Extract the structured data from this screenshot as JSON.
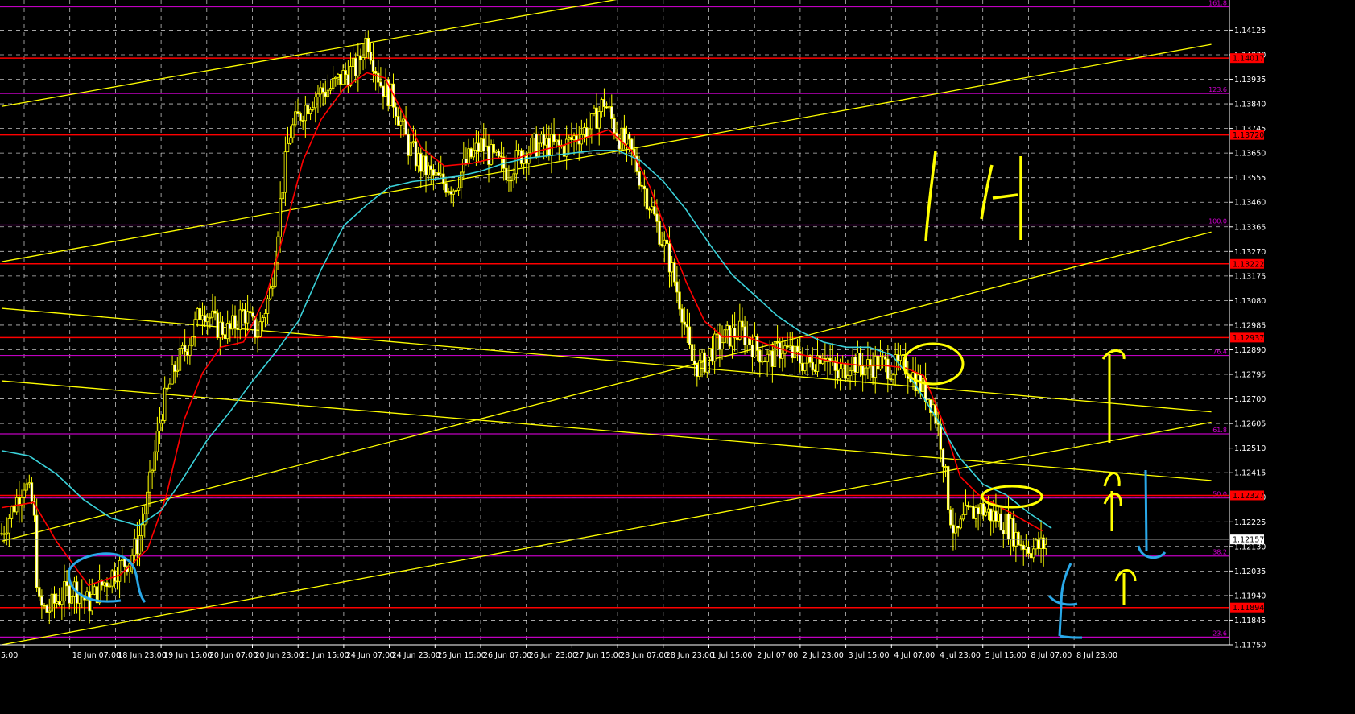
{
  "chart_data": {
    "type": "candlestick",
    "symbol": "",
    "price_axis": {
      "range": [
        1.1175,
        1.14215
      ],
      "ticks": [
        "1.14125",
        "1.14030",
        "1.13935",
        "1.13840",
        "1.13745",
        "1.13650",
        "1.13555",
        "1.13460",
        "1.13365",
        "1.13270",
        "1.13175",
        "1.13080",
        "1.12985",
        "1.12890",
        "1.12795",
        "1.12700",
        "1.12605",
        "1.12510",
        "1.12415",
        "1.12320",
        "1.12225",
        "1.12130",
        "1.12035",
        "1.11940",
        "1.11845",
        "1.11750"
      ],
      "tick_values": [
        1.14125,
        1.1403,
        1.13935,
        1.1384,
        1.13745,
        1.1365,
        1.13555,
        1.1346,
        1.13365,
        1.1327,
        1.13175,
        1.1308,
        1.12985,
        1.1289,
        1.12795,
        1.127,
        1.12605,
        1.1251,
        1.12415,
        1.1232,
        1.12225,
        1.1213,
        1.12035,
        1.1194,
        1.11845,
        1.1175
      ]
    },
    "time_axis": {
      "labels": [
        "5:00",
        "18 Jun 07:00",
        "18 Jun 23:00",
        "19 Jun 15:00",
        "20 Jun 07:00",
        "20 Jun 23:00",
        "21 Jun 15:00",
        "24 Jun 07:00",
        "24 Jun 23:00",
        "25 Jun 15:00",
        "26 Jun 07:00",
        "26 Jun 23:00",
        "27 Jun 15:00",
        "28 Jun 07:00",
        "28 Jun 23:00",
        "1 Jul 15:00",
        "2 Jul 07:00",
        "2 Jul 23:00",
        "3 Jul 15:00",
        "4 Jul 07:00",
        "4 Jul 23:00",
        "5 Jul 15:00",
        "8 Jul 07:00",
        "8 Jul 23:00"
      ],
      "positions": [
        0,
        1.0,
        2.0,
        3.0,
        4.0,
        5.0,
        6.0,
        7.0,
        8.0,
        9.0,
        10.0,
        11.0,
        12.0,
        13.0,
        14.0,
        15.0,
        16.0,
        17.0,
        18.0,
        19.0,
        20.0,
        21.0,
        22.0,
        23.0
      ]
    },
    "current_price": {
      "value": 1.12157,
      "label": "1.12157"
    },
    "horizontal_levels": [
      {
        "value": 1.14017,
        "label": "1.14017",
        "color": "#ff0000"
      },
      {
        "value": 1.1372,
        "label": "1.13720",
        "color": "#ff0000"
      },
      {
        "value": 1.13222,
        "label": "1.13222",
        "color": "#ff0000"
      },
      {
        "value": 1.12937,
        "label": "1.12937",
        "color": "#ff0000"
      },
      {
        "value": 1.12327,
        "label": "1.12327",
        "color": "#ff0000"
      },
      {
        "value": 1.11894,
        "label": "1.11894",
        "color": "#ff0000"
      }
    ],
    "fib_levels": [
      {
        "value": 1.14215,
        "label": "161.8"
      },
      {
        "value": 1.1388,
        "label": "123.6"
      },
      {
        "value": 1.13372,
        "label": "100.0"
      },
      {
        "value": 1.12868,
        "label": "76.4"
      },
      {
        "value": 1.12565,
        "label": "61.8"
      },
      {
        "value": 1.12317,
        "label": "50.0"
      },
      {
        "value": 1.12093,
        "label": "38.2"
      },
      {
        "value": 1.1178,
        "label": "23.6"
      }
    ],
    "trendlines": [
      {
        "p1": [
          0,
          1.1383
        ],
        "p2": [
          23.8,
          1.1456
        ]
      },
      {
        "p1": [
          0,
          1.1323
        ],
        "p2": [
          26.5,
          1.1407
        ]
      },
      {
        "p1": [
          0,
          1.1215
        ],
        "p2": [
          26.5,
          1.13345
        ]
      },
      {
        "p1": [
          0,
          1.1175
        ],
        "p2": [
          26.5,
          1.1261
        ]
      },
      {
        "p1": [
          0,
          1.1305
        ],
        "p2": [
          26.5,
          1.1265
        ]
      },
      {
        "p1": [
          0,
          1.1277
        ],
        "p2": [
          26.5,
          1.12385
        ]
      }
    ],
    "price_path": [
      [
        0,
        1.1218
      ],
      [
        0.5,
        1.1238
      ],
      [
        0.7,
        1.1228
      ],
      [
        0.8,
        1.119
      ],
      [
        1.0,
        1.1188
      ],
      [
        1.3,
        1.1194
      ],
      [
        1.6,
        1.1197
      ],
      [
        1.9,
        1.1191
      ],
      [
        2.2,
        1.1198
      ],
      [
        2.5,
        1.1204
      ],
      [
        2.8,
        1.1208
      ],
      [
        3.0,
        1.1215
      ],
      [
        3.2,
        1.1232
      ],
      [
        3.5,
        1.1265
      ],
      [
        3.8,
        1.1282
      ],
      [
        4.1,
        1.1292
      ],
      [
        4.4,
        1.1306
      ],
      [
        4.7,
        1.1298
      ],
      [
        5.0,
        1.1296
      ],
      [
        5.3,
        1.1304
      ],
      [
        5.6,
        1.1295
      ],
      [
        5.9,
        1.1312
      ],
      [
        6.1,
        1.1345
      ],
      [
        6.3,
        1.1372
      ],
      [
        6.6,
        1.1382
      ],
      [
        6.9,
        1.1388
      ],
      [
        7.2,
        1.139
      ],
      [
        7.5,
        1.1395
      ],
      [
        7.8,
        1.1398
      ],
      [
        8.0,
        1.141
      ],
      [
        8.3,
        1.1392
      ],
      [
        8.6,
        1.1385
      ],
      [
        8.9,
        1.1368
      ],
      [
        9.2,
        1.136
      ],
      [
        9.5,
        1.1355
      ],
      [
        9.9,
        1.1352
      ],
      [
        10.2,
        1.1362
      ],
      [
        10.5,
        1.1368
      ],
      [
        10.8,
        1.1362
      ],
      [
        11.1,
        1.1358
      ],
      [
        11.4,
        1.1365
      ],
      [
        11.7,
        1.1368
      ],
      [
        12.0,
        1.1368
      ],
      [
        12.3,
        1.1367
      ],
      [
        12.6,
        1.1372
      ],
      [
        12.9,
        1.1375
      ],
      [
        13.2,
        1.1385
      ],
      [
        13.5,
        1.1372
      ],
      [
        13.8,
        1.1365
      ],
      [
        14.0,
        1.1355
      ],
      [
        14.3,
        1.134
      ],
      [
        14.6,
        1.1325
      ],
      [
        14.9,
        1.1305
      ],
      [
        15.1,
        1.1285
      ],
      [
        15.3,
        1.1282
      ],
      [
        15.6,
        1.129
      ],
      [
        15.9,
        1.1294
      ],
      [
        16.2,
        1.1296
      ],
      [
        16.5,
        1.129
      ],
      [
        16.8,
        1.1285
      ],
      [
        17.1,
        1.129
      ],
      [
        17.4,
        1.1286
      ],
      [
        17.7,
        1.1283
      ],
      [
        18.0,
        1.1289
      ],
      [
        18.3,
        1.1278
      ],
      [
        18.6,
        1.1285
      ],
      [
        18.9,
        1.1282
      ],
      [
        19.2,
        1.1284
      ],
      [
        19.5,
        1.1282
      ],
      [
        19.8,
        1.1283
      ],
      [
        20.1,
        1.1276
      ],
      [
        20.4,
        1.1268
      ],
      [
        20.6,
        1.1252
      ],
      [
        20.75,
        1.1228
      ],
      [
        20.9,
        1.1216
      ],
      [
        21.1,
        1.1224
      ],
      [
        21.4,
        1.1228
      ],
      [
        21.7,
        1.1225
      ],
      [
        22.0,
        1.1222
      ],
      [
        22.3,
        1.1215
      ],
      [
        22.6,
        1.1212
      ],
      [
        22.9,
        1.1214
      ]
    ],
    "moving_averages": [
      {
        "color": "#ff0000",
        "points": [
          [
            0,
            1.1228
          ],
          [
            0.7,
            1.123
          ],
          [
            1.2,
            1.1215
          ],
          [
            1.9,
            1.1198
          ],
          [
            2.6,
            1.1202
          ],
          [
            3.2,
            1.1212
          ],
          [
            3.6,
            1.1232
          ],
          [
            4.0,
            1.1262
          ],
          [
            4.4,
            1.128
          ],
          [
            4.8,
            1.129
          ],
          [
            5.3,
            1.1292
          ],
          [
            5.8,
            1.131
          ],
          [
            6.2,
            1.1335
          ],
          [
            6.6,
            1.1362
          ],
          [
            7.0,
            1.1378
          ],
          [
            7.5,
            1.139
          ],
          [
            8.0,
            1.1396
          ],
          [
            8.4,
            1.1394
          ],
          [
            8.8,
            1.138
          ],
          [
            9.2,
            1.1367
          ],
          [
            9.7,
            1.136
          ],
          [
            10.3,
            1.1361
          ],
          [
            10.8,
            1.1363
          ],
          [
            11.3,
            1.1363
          ],
          [
            11.8,
            1.1366
          ],
          [
            12.3,
            1.1368
          ],
          [
            12.8,
            1.1371
          ],
          [
            13.3,
            1.1374
          ],
          [
            13.8,
            1.1366
          ],
          [
            14.2,
            1.1352
          ],
          [
            14.6,
            1.1333
          ],
          [
            15.0,
            1.1315
          ],
          [
            15.4,
            1.13
          ],
          [
            15.8,
            1.1294
          ],
          [
            16.3,
            1.1294
          ],
          [
            16.8,
            1.1291
          ],
          [
            17.3,
            1.1288
          ],
          [
            17.8,
            1.1286
          ],
          [
            18.3,
            1.1284
          ],
          [
            18.8,
            1.1283
          ],
          [
            19.3,
            1.1283
          ],
          [
            19.8,
            1.1282
          ],
          [
            20.2,
            1.1279
          ],
          [
            20.6,
            1.1262
          ],
          [
            21.0,
            1.124
          ],
          [
            21.4,
            1.1233
          ],
          [
            21.8,
            1.1229
          ],
          [
            22.3,
            1.1224
          ],
          [
            22.8,
            1.1219
          ]
        ]
      },
      {
        "color": "#3ad0d8",
        "points": [
          [
            0,
            1.125
          ],
          [
            0.6,
            1.1248
          ],
          [
            1.2,
            1.1241
          ],
          [
            1.8,
            1.1231
          ],
          [
            2.4,
            1.1224
          ],
          [
            3.0,
            1.1221
          ],
          [
            3.5,
            1.1227
          ],
          [
            4.0,
            1.124
          ],
          [
            4.5,
            1.1254
          ],
          [
            5.0,
            1.1265
          ],
          [
            5.5,
            1.1277
          ],
          [
            6.0,
            1.1288
          ],
          [
            6.5,
            1.13
          ],
          [
            7.0,
            1.132
          ],
          [
            7.5,
            1.1337
          ],
          [
            8.0,
            1.1345
          ],
          [
            8.5,
            1.1352
          ],
          [
            9.0,
            1.1354
          ],
          [
            9.5,
            1.1355
          ],
          [
            10.0,
            1.1356
          ],
          [
            10.5,
            1.1358
          ],
          [
            11.0,
            1.1361
          ],
          [
            11.5,
            1.1363
          ],
          [
            12.0,
            1.1364
          ],
          [
            12.5,
            1.1365
          ],
          [
            13.0,
            1.1366
          ],
          [
            13.5,
            1.1366
          ],
          [
            14.0,
            1.1362
          ],
          [
            14.5,
            1.1354
          ],
          [
            15.0,
            1.1343
          ],
          [
            15.5,
            1.133
          ],
          [
            16.0,
            1.1318
          ],
          [
            16.5,
            1.131
          ],
          [
            17.0,
            1.1302
          ],
          [
            17.5,
            1.1296
          ],
          [
            18.0,
            1.1292
          ],
          [
            18.5,
            1.129
          ],
          [
            19.0,
            1.129
          ],
          [
            19.5,
            1.1287
          ],
          [
            20.0,
            1.1276
          ],
          [
            20.5,
            1.1262
          ],
          [
            21.0,
            1.1247
          ],
          [
            21.5,
            1.1237
          ],
          [
            22.0,
            1.1233
          ],
          [
            22.5,
            1.1226
          ],
          [
            23.0,
            1.122
          ]
        ]
      }
    ],
    "annotations": [
      {
        "text": "H",
        "color": "#ffff00"
      }
    ],
    "grid": true
  }
}
